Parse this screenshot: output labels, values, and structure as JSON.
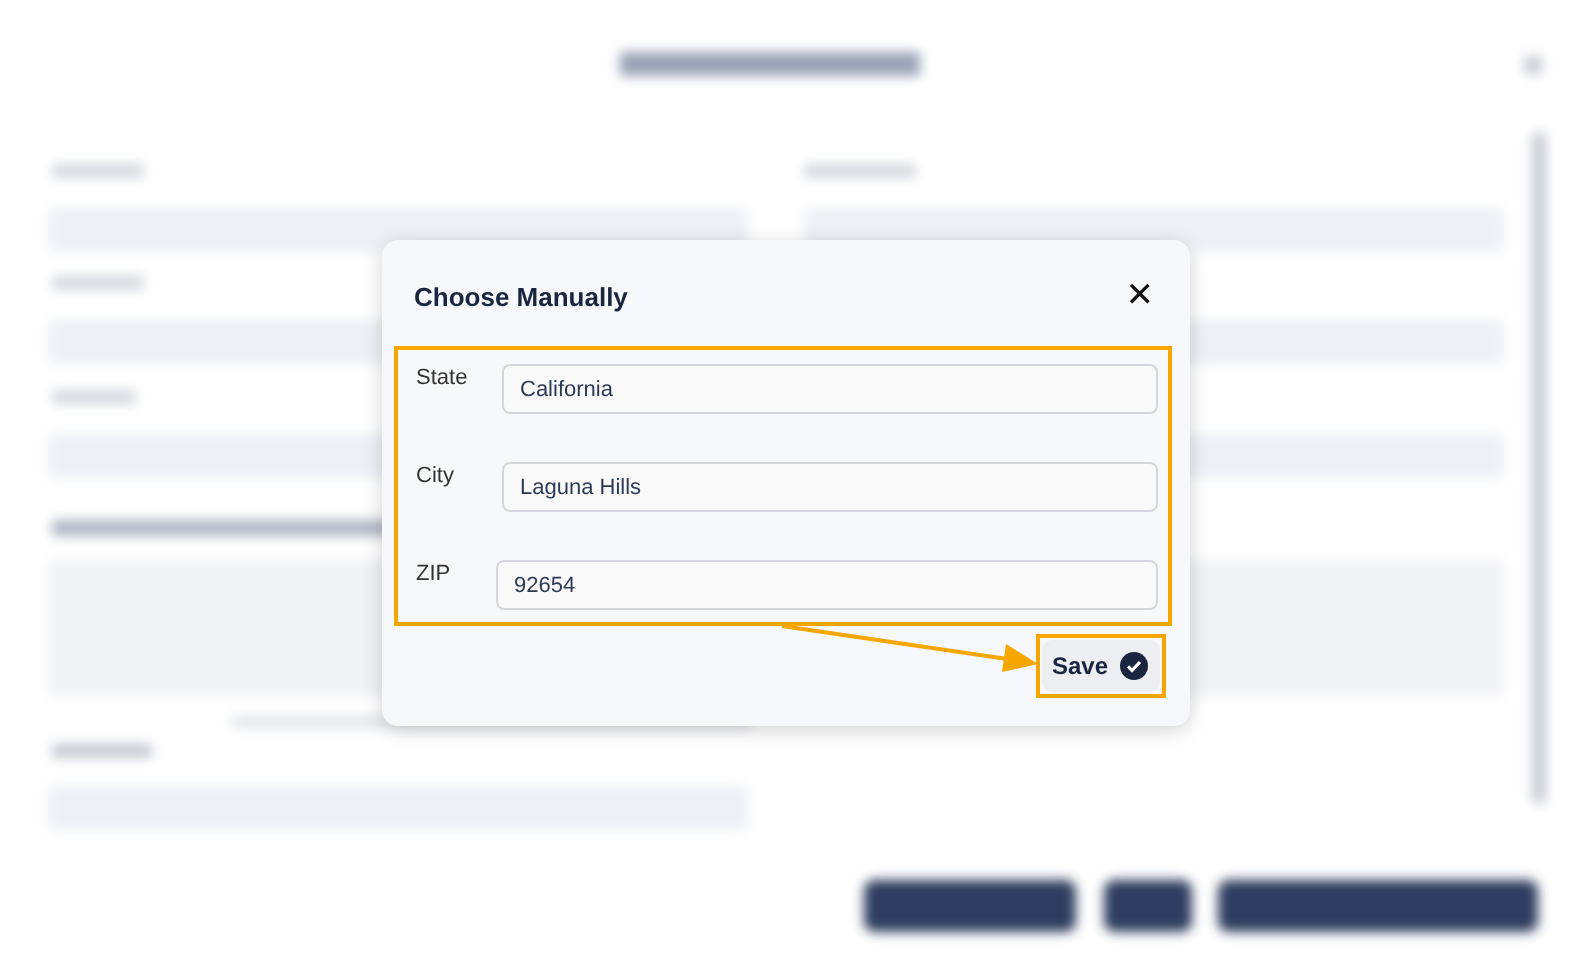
{
  "dialog": {
    "title": "Choose Manually",
    "close": "✕",
    "fields": [
      {
        "label": "State",
        "value": "California"
      },
      {
        "label": "City",
        "value": "Laguna Hills"
      },
      {
        "label": "ZIP",
        "value": "92654"
      }
    ],
    "save_button": {
      "label": "Save"
    }
  }
}
